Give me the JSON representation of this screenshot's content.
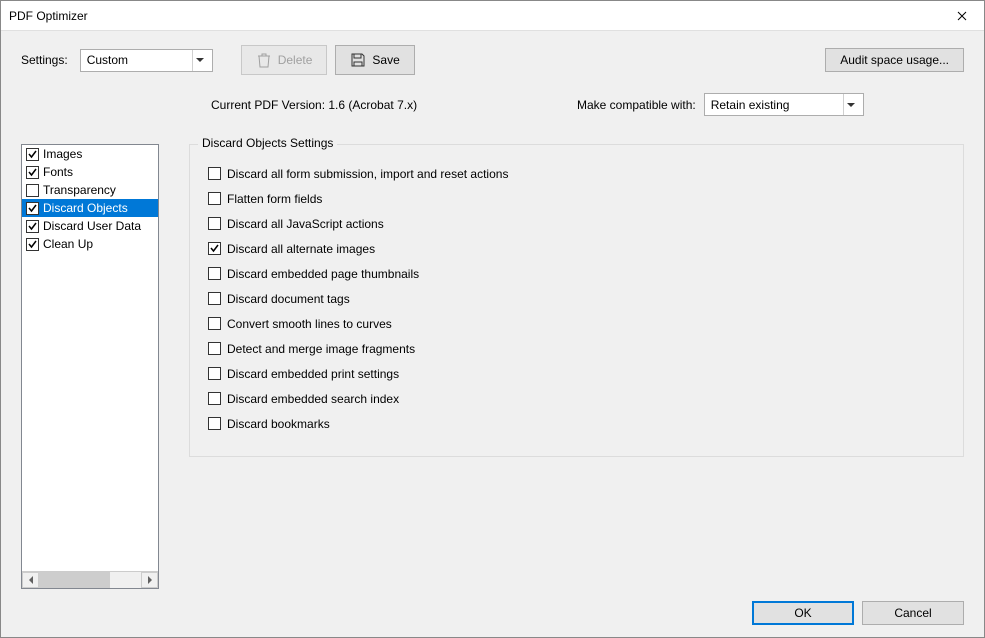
{
  "window": {
    "title": "PDF Optimizer"
  },
  "toolbar": {
    "settings_label": "Settings:",
    "settings_value": "Custom",
    "delete_label": "Delete",
    "save_label": "Save",
    "audit_label": "Audit space usage..."
  },
  "info": {
    "current_version": "Current PDF Version: 1.6 (Acrobat 7.x)",
    "compat_label": "Make compatible with:",
    "compat_value": "Retain existing"
  },
  "sidebar": {
    "items": [
      {
        "label": "Images",
        "checked": true,
        "selected": false
      },
      {
        "label": "Fonts",
        "checked": true,
        "selected": false
      },
      {
        "label": "Transparency",
        "checked": false,
        "selected": false
      },
      {
        "label": "Discard Objects",
        "checked": true,
        "selected": true
      },
      {
        "label": "Discard User Data",
        "checked": true,
        "selected": false
      },
      {
        "label": "Clean Up",
        "checked": true,
        "selected": false
      }
    ]
  },
  "group": {
    "title": "Discard Objects Settings",
    "options": [
      {
        "label": "Discard all form submission, import and reset actions",
        "checked": false
      },
      {
        "label": "Flatten form fields",
        "checked": false
      },
      {
        "label": "Discard all JavaScript actions",
        "checked": false
      },
      {
        "label": "Discard all alternate images",
        "checked": true
      },
      {
        "label": "Discard embedded page thumbnails",
        "checked": false
      },
      {
        "label": "Discard document tags",
        "checked": false
      },
      {
        "label": "Convert smooth lines to curves",
        "checked": false
      },
      {
        "label": "Detect and merge image fragments",
        "checked": false
      },
      {
        "label": "Discard embedded print settings",
        "checked": false
      },
      {
        "label": "Discard embedded search index",
        "checked": false
      },
      {
        "label": "Discard bookmarks",
        "checked": false
      }
    ]
  },
  "buttons": {
    "ok": "OK",
    "cancel": "Cancel"
  }
}
